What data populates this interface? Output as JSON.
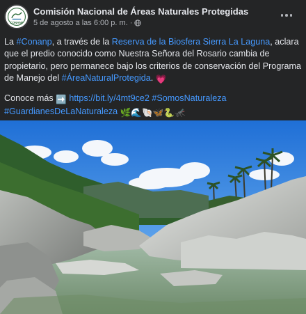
{
  "post": {
    "author": "Comisión Nacional de Áreas Naturales Protegidas",
    "avatar_text": "CONANP",
    "timestamp": "5 de agosto a las 6:00 p. m.",
    "separator": "·",
    "audience_icon": "globe-icon",
    "more_icon": "more-options-icon",
    "text": {
      "p1_t1": "La ",
      "p1_link1": "#Conanp",
      "p1_t2": ", a través de la ",
      "p1_link2": "Reserva de la Biosfera Sierra La Laguna",
      "p1_t3": ", aclara que el predio conocido como Nuestra Señora del Rosario cambia de propietario, pero permanece bajo los criterios de conservación del Programa de Manejo del ",
      "p1_link3": "#ÁreaNaturalProtegida",
      "p1_t4": ". ",
      "p1_emoji": "💗",
      "p2_t1": "Conoce más ",
      "p2_emoji_arrow": "➡️",
      "p2_link1": "https://bit.ly/4mt9ce2",
      "p2_link2": "#SomosNaturaleza",
      "p2_link3": "#GuardianesDeLaNaturaleza",
      "p2_emojis": "🌿🌊🐚🦋🐍🦟"
    },
    "photo_icon": "landscape-photo",
    "colors": {
      "background": "#242526",
      "text": "#e4e6eb",
      "secondary": "#b0b3b8",
      "link": "#4599ff"
    }
  }
}
